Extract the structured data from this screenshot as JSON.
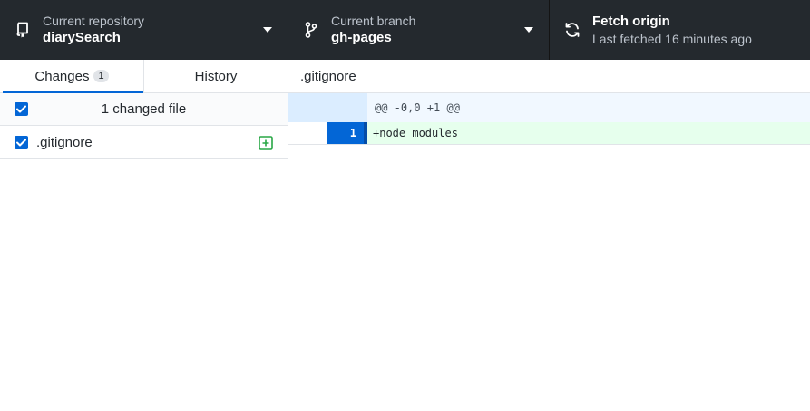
{
  "toolbar": {
    "repository": {
      "sub_label": "Current repository",
      "name": "diarySearch",
      "icon": "repo-icon"
    },
    "branch": {
      "sub_label": "Current branch",
      "name": "gh-pages",
      "icon": "git-branch-icon"
    },
    "fetch": {
      "title": "Fetch origin",
      "status": "Last fetched 16 minutes ago",
      "icon": "sync-icon"
    }
  },
  "sidebar": {
    "tabs": [
      {
        "label": "Changes",
        "count": "1",
        "active": true
      },
      {
        "label": "History",
        "active": false
      }
    ],
    "changes_header": {
      "label": "1 changed file",
      "checked": true
    },
    "files": [
      {
        "name": ".gitignore",
        "checked": true,
        "status": "added"
      }
    ]
  },
  "diff": {
    "file_name": ".gitignore",
    "hunk_header": "@@ -0,0 +1 @@",
    "lines": [
      {
        "new_line_number": "1",
        "text": "+node_modules",
        "type": "added"
      }
    ]
  },
  "colors": {
    "toolbar_bg": "#24292e",
    "accent": "#0366d6",
    "added_bg": "#e6ffed",
    "added_icon": "#28a745",
    "hunk_bg": "#f1f8ff"
  }
}
